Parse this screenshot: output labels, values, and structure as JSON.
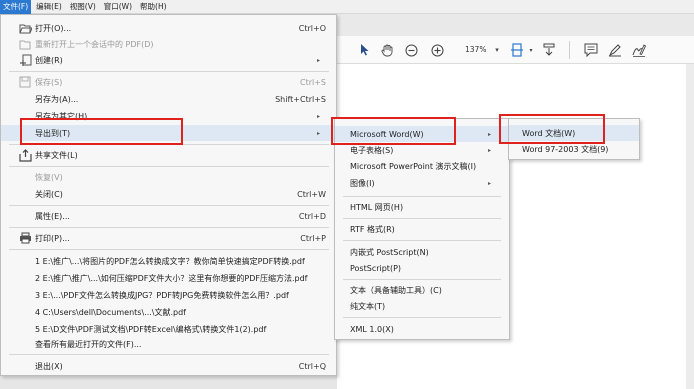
{
  "menubar": {
    "items": [
      "文件(F)",
      "编辑(E)",
      "视图(V)",
      "窗口(W)",
      "帮助(H)"
    ]
  },
  "toolbar": {
    "zoom": "137%",
    "icons": [
      "select-arrow-icon",
      "hand-icon",
      "zoom-out-icon",
      "zoom-in-icon",
      "fit-page-icon",
      "scroll-icon",
      "comment-icon",
      "highlight-pen-icon",
      "sign-icon"
    ]
  },
  "file_menu": {
    "open": {
      "label": "打开(O)...",
      "shortcut": "Ctrl+O"
    },
    "reopen": {
      "label": "重新打开上一个会话中的 PDF(D)"
    },
    "create": {
      "label": "创建(R)"
    },
    "save": {
      "label": "保存(S)",
      "shortcut": "Ctrl+S"
    },
    "save_as": {
      "label": "另存为(A)...",
      "shortcut": "Shift+Ctrl+S"
    },
    "save_as_other": {
      "label": "另存为其它(H)"
    },
    "export_to": {
      "label": "导出到(T)"
    },
    "share": {
      "label": "共享文件(L)"
    },
    "revert": {
      "label": "恢复(V)"
    },
    "close": {
      "label": "关闭(C)",
      "shortcut": "Ctrl+W"
    },
    "properties": {
      "label": "属性(E)...",
      "shortcut": "Ctrl+D"
    },
    "print": {
      "label": "打印(P)...",
      "shortcut": "Ctrl+P"
    },
    "recent": [
      "1 E:\\推广\\...\\将图片的PDF怎么转换成文字？教你简单快速搞定PDF转换.pdf",
      "2 E:\\推广\\推广\\...\\如何压缩PDF文件大小？这里有你想要的PDF压缩方法.pdf",
      "3 E:\\...\\PDF文件怎么转换成JPG？PDF转JPG免费转换软件怎么用？.pdf",
      "4 C:\\Users\\dell\\Documents\\...\\文献.pdf",
      "5 E:\\D文件\\PDF测试文档\\PDF转Excel\\编格式\\转换文件1(2).pdf"
    ],
    "view_all_recent": {
      "label": "查看所有最近打开的文件(F)..."
    },
    "exit": {
      "label": "退出(X)",
      "shortcut": "Ctrl+Q"
    }
  },
  "export_submenu": {
    "items": [
      {
        "label": "Microsoft Word(W)",
        "has_sub": true
      },
      {
        "label": "电子表格(S)",
        "has_sub": true
      },
      {
        "label": "Microsoft PowerPoint 演示文稿(I)",
        "has_sub": false
      },
      {
        "label": "图像(I)",
        "has_sub": true
      },
      {
        "label": "HTML 网页(H)",
        "has_sub": false
      },
      {
        "label": "RTF 格式(R)",
        "has_sub": false
      },
      {
        "label": "内嵌式 PostScript(N)",
        "has_sub": false
      },
      {
        "label": "PostScript(P)",
        "has_sub": false
      },
      {
        "label": "文本（具备辅助工具）(C)",
        "has_sub": false
      },
      {
        "label": "纯文本(T)",
        "has_sub": false
      },
      {
        "label": "XML 1.0(X)",
        "has_sub": false
      }
    ]
  },
  "word_submenu": {
    "items": [
      "Word 文档(W)",
      "Word 97-2003 文档(9)"
    ]
  },
  "colors": {
    "highlight": "#dde8f4",
    "annotation_red": "#e0221f",
    "menubar_active": "#2b79d0"
  }
}
